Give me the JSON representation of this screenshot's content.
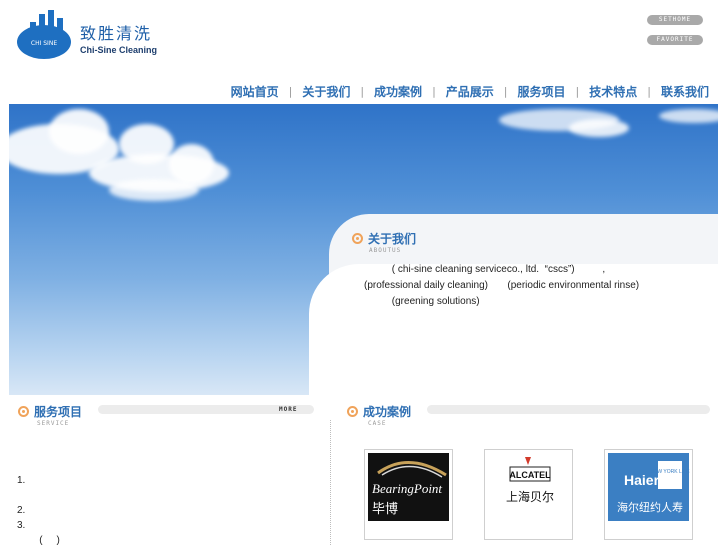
{
  "brand": {
    "name_cn": "致胜清洗",
    "name_en": "Chi-Sine Cleaning",
    "mark_text": "CHI SINE"
  },
  "top_links": {
    "sethome": "SETHOME",
    "favorite": "FAVORITE"
  },
  "nav": [
    "网站首页",
    "关于我们",
    "成功案例",
    "产品展示",
    "服务项目",
    "技术特点",
    "联系我们"
  ],
  "about": {
    "title": "关于我们",
    "subtitle": "ABOUTUS",
    "lines": [
      "          ( chi-sine cleaning serviceco., ltd.  “cscs”)          ,",
      "(professional daily cleaning)       (periodic environmental rinse)",
      "          (greening solutions)"
    ]
  },
  "service": {
    "title": "服务项目",
    "subtitle": "SERVICE",
    "more": "MORE",
    "items": [
      "1.",
      "2.",
      "3.",
      "        (     )"
    ]
  },
  "cases": {
    "title": "成功案例",
    "subtitle": "CASE",
    "logos": [
      {
        "name": "BearingPoint",
        "sub": "毕博"
      },
      {
        "name": "ALCATEL",
        "sub": "上海贝尔"
      },
      {
        "name": "Haier",
        "sub": "海尔纽约人寿",
        "badge": "NEW YORK LIFE"
      }
    ]
  },
  "colors": {
    "accent": "#2f6fb3",
    "icon": "#f0a35a",
    "sky": "#4f8fd6"
  }
}
